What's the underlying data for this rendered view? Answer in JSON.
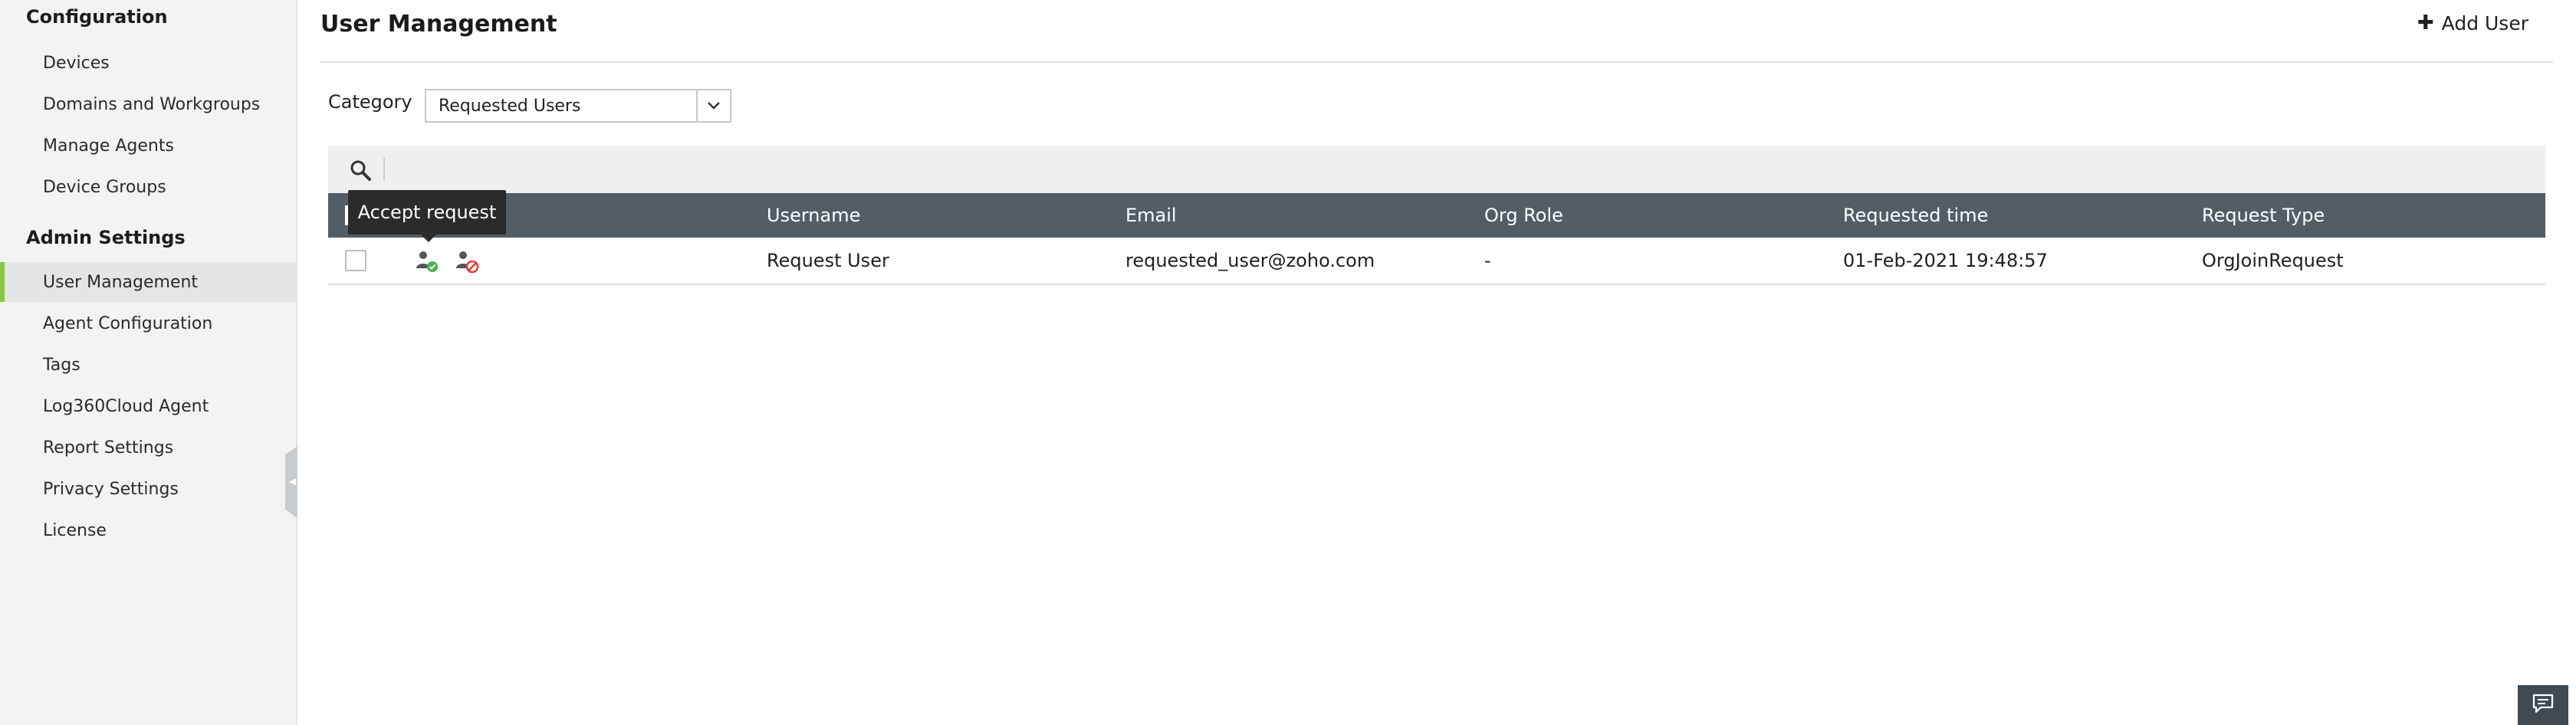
{
  "sidebar": {
    "configuration_heading": "Configuration",
    "configuration_items": [
      {
        "label": "Devices"
      },
      {
        "label": "Domains and Workgroups"
      },
      {
        "label": "Manage Agents"
      },
      {
        "label": "Device Groups"
      }
    ],
    "admin_heading": "Admin Settings",
    "admin_items": [
      {
        "label": "User Management",
        "active": true
      },
      {
        "label": "Agent Configuration"
      },
      {
        "label": "Tags"
      },
      {
        "label": "Log360Cloud Agent"
      },
      {
        "label": "Report Settings"
      },
      {
        "label": "Privacy Settings"
      },
      {
        "label": "License"
      }
    ],
    "collapse_icon": "chevron-left-icon"
  },
  "header": {
    "title": "User Management",
    "add_user_icon": "plus-icon",
    "add_user_label": "Add User"
  },
  "filter": {
    "category_label": "Category",
    "category_selected": "Requested Users"
  },
  "table": {
    "search_icon": "search-icon",
    "columns": [
      "Username",
      "Email",
      "Org Role",
      "Requested time",
      "Request Type"
    ],
    "rows": [
      {
        "username": "Request User",
        "email": "requested_user@zoho.com",
        "org_role": "-",
        "requested_time": "01-Feb-2021 19:48:57",
        "request_type": "OrgJoinRequest",
        "accept_icon": "accept-user-icon",
        "reject_icon": "reject-user-icon"
      }
    ]
  },
  "tooltip": {
    "text": "Accept request"
  },
  "chat": {
    "icon": "chat-icon"
  },
  "colors": {
    "sidebar_bg": "#f2f3f3",
    "active_accent": "#8dc63f",
    "table_header_bg": "#525d65",
    "tooltip_bg": "#2b2b2b",
    "accept_green": "#4caf50",
    "reject_red": "#e53935"
  }
}
